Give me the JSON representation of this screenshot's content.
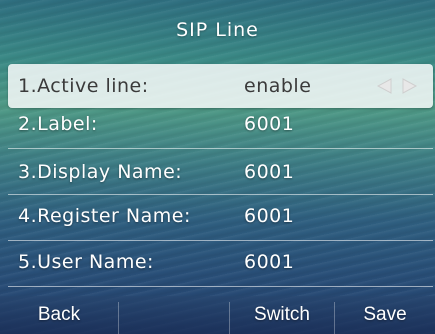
{
  "header": {
    "title": "SIP Line"
  },
  "rows": [
    {
      "label": "1.Active line:",
      "value": "enable"
    },
    {
      "label": "2.Label:",
      "value": "6001"
    },
    {
      "label": "3.Display Name:",
      "value": "6001"
    },
    {
      "label": "4.Register Name:",
      "value": "6001"
    },
    {
      "label": "5.User Name:",
      "value": "6001"
    }
  ],
  "selected_row_icons": [
    "arrow-left-icon",
    "arrow-right-icon"
  ],
  "softkeys": {
    "back": "Back",
    "slot2": "",
    "switch": "Switch",
    "save": "Save"
  },
  "colors": {
    "highlight": "#d7dadc",
    "text": "#ffffff",
    "highlight_text": "#3a3a3a"
  }
}
